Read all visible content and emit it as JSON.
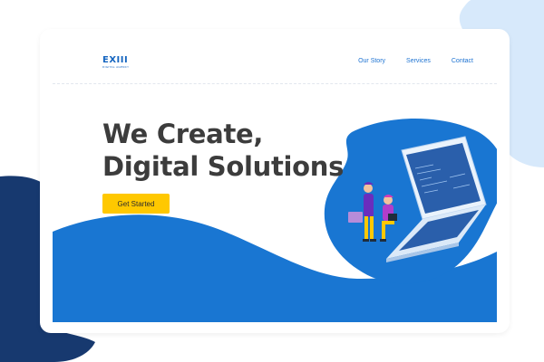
{
  "brand": {
    "logo_mark": "EXIII",
    "logo_sub": "DIGITAL AGENCY"
  },
  "nav": {
    "items": [
      {
        "label": "Our Story"
      },
      {
        "label": "Services"
      },
      {
        "label": "Contact"
      }
    ]
  },
  "hero": {
    "title_line1": "We Create,",
    "title_line2": "Digital Solutions",
    "cta_label": "Get Started"
  },
  "colors": {
    "primary_blue": "#1976d2",
    "dark_navy": "#17396f",
    "light_blue_bg": "#d7e9fb",
    "cta_yellow": "#ffc800",
    "title_text": "#3c3c3c",
    "nav_text": "#1e73d2"
  },
  "illustration": {
    "subject": "laptop-with-people-icon"
  }
}
